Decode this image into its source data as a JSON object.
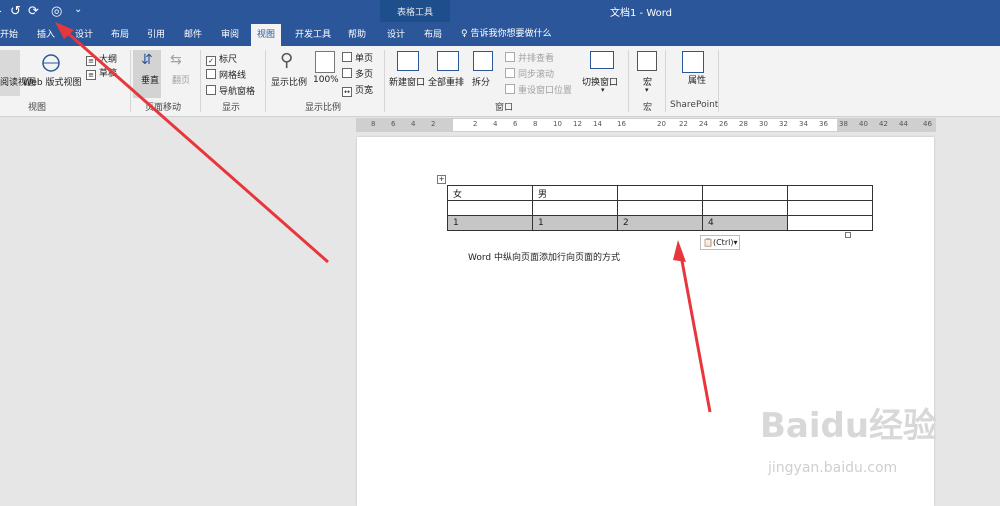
{
  "window": {
    "title": "文档1 - Word",
    "context_group": "表格工具"
  },
  "qat": {
    "undo_icon": "undo-icon",
    "redo_icon": "redo-icon",
    "touch_icon": "touch-mode-icon",
    "customize_icon": "customize-qat-icon"
  },
  "tabs": [
    {
      "label": "开始"
    },
    {
      "label": "插入"
    },
    {
      "label": "设计"
    },
    {
      "label": "布局"
    },
    {
      "label": "引用"
    },
    {
      "label": "邮件"
    },
    {
      "label": "审阅"
    },
    {
      "label": "视图",
      "active": true
    },
    {
      "label": "开发工具"
    },
    {
      "label": "帮助"
    },
    {
      "label": "设计"
    },
    {
      "label": "布局"
    }
  ],
  "tell_me": "告诉我你想要做什么",
  "ribbon": {
    "views": {
      "read_mode": "阅读视图",
      "web_layout": "Web 版式视图",
      "outline": "大纲",
      "draft": "草稿",
      "label": "视图"
    },
    "page_movement": {
      "vertical": "垂直",
      "side": "翻页",
      "label": "页面移动"
    },
    "show": {
      "ruler": "标尺",
      "gridlines": "网格线",
      "nav_pane": "导航窗格",
      "label": "显示"
    },
    "zoom": {
      "zoom": "显示比例",
      "hundred": "100%",
      "one_page": "单页",
      "multi_page": "多页",
      "page_width": "页宽",
      "label": "显示比例"
    },
    "window": {
      "new_window": "新建窗口",
      "arrange_all": "全部重排",
      "split": "拆分",
      "side_by_side": "并排查看",
      "sync_scroll": "同步滚动",
      "reset_pos": "重设窗口位置",
      "switch": "切换窗口",
      "label": "窗口"
    },
    "macros": {
      "macros": "宏",
      "label": "宏"
    },
    "sharepoint": {
      "properties": "属性",
      "label": "SharePoint"
    }
  },
  "ruler": [
    "8",
    "6",
    "4",
    "2",
    "2",
    "4",
    "6",
    "8",
    "10",
    "12",
    "14",
    "16",
    "20",
    "22",
    "24",
    "26",
    "28",
    "30",
    "32",
    "34",
    "36",
    "38",
    "40",
    "42",
    "44",
    "46"
  ],
  "table": {
    "rows": [
      [
        "女",
        "男",
        "",
        "",
        ""
      ],
      [
        "",
        "",
        "",
        "",
        ""
      ],
      [
        "1",
        "1",
        "2",
        "4",
        ""
      ]
    ]
  },
  "paste_options": "(Ctrl)",
  "caption": "Word 中纵向页面添加行向页面的方式",
  "watermark": {
    "brand": "Baidu经验",
    "url": "jingyan.baidu.com"
  },
  "colors": {
    "brand": "#2b579a",
    "arrow": "#e8363d"
  }
}
